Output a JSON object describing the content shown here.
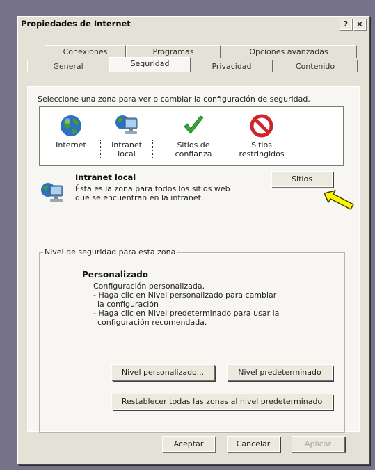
{
  "dialog": {
    "title": "Propiedades de Internet",
    "help_button": "?",
    "close_button": "×"
  },
  "tabs": {
    "row1": [
      "Conexiones",
      "Programas",
      "Opciones avanzadas"
    ],
    "row2": [
      "General",
      "Seguridad",
      "Privacidad",
      "Contenido"
    ],
    "active": "Seguridad"
  },
  "security": {
    "instruction": "Seleccione una zona para ver o cambiar la configuración de seguridad.",
    "zones": [
      {
        "label": "Internet",
        "icon": "globe-icon"
      },
      {
        "label": "Intranet local",
        "icon": "network-computer-icon",
        "selected": true
      },
      {
        "label": "Sitios de confianza",
        "icon": "checkmark-icon"
      },
      {
        "label": "Sitios restringidos",
        "icon": "prohibited-icon"
      }
    ],
    "selected_zone": {
      "title": "Intranet local",
      "description": "Ésta es la zona para todos los sitios web que se encuentran en la intranet.",
      "sites_button": "Sitios"
    },
    "level_group": {
      "title": "Nivel de seguridad para esta zona",
      "level_name": "Personalizado",
      "lines": [
        "Configuración personalizada.",
        "- Haga clic en Nivel personalizado para cambiar",
        "  la configuración",
        "- Haga clic en Nivel predeterminado para usar la",
        "  configuración recomendada."
      ],
      "custom_button": "Nivel personalizado...",
      "default_button": "Nivel predeterminado"
    },
    "reset_button": "Restablecer todas las zonas al nivel predeterminado"
  },
  "footer": {
    "ok": "Aceptar",
    "cancel": "Cancelar",
    "apply": "Aplicar"
  },
  "colors": {
    "background": "#77738a",
    "dialog": "#e4e1d6",
    "panel": "#f7f6f2",
    "arrow": "#fff200"
  }
}
